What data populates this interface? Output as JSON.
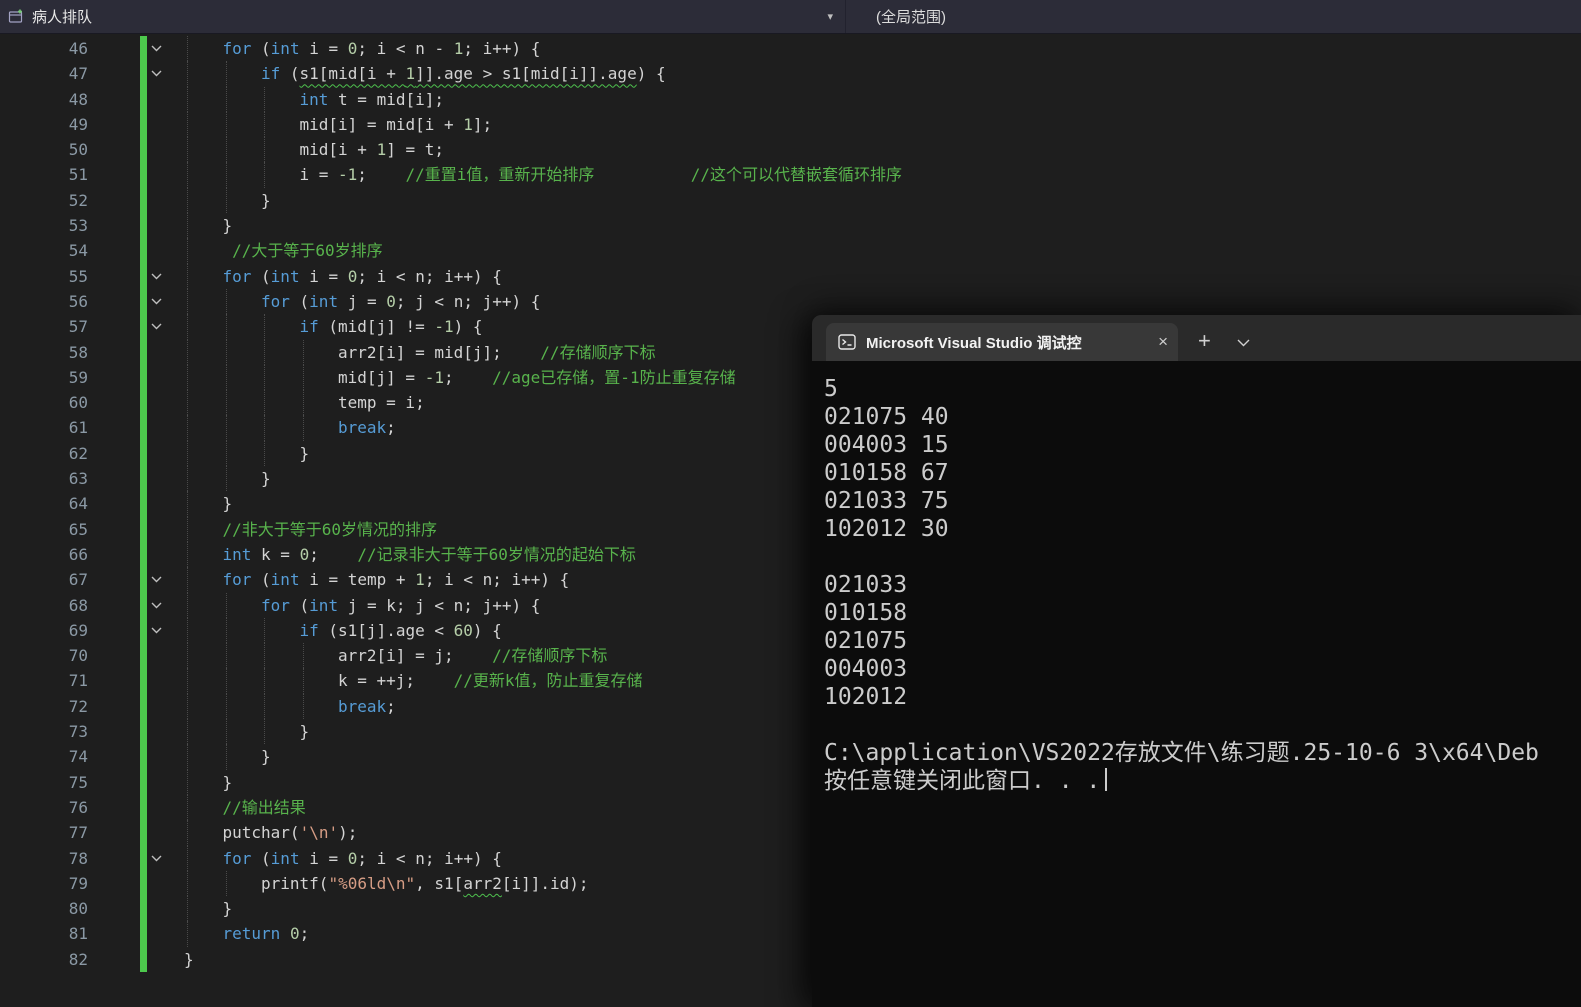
{
  "navbar": {
    "title": "病人排队",
    "scope": "(全局范围)"
  },
  "colors": {
    "editor_background": "#1e1e1e",
    "change_bar_green": "#4dc94d",
    "keyword_blue": "#569cd6",
    "comment_green": "#57a64a",
    "string_orange": "#d69d85",
    "number_green": "#b5cea8",
    "console_background": "#0c0c0c"
  },
  "editor": {
    "lines": [
      {
        "n": 46,
        "fold": true,
        "indent": 1,
        "segs": [
          [
            "kw",
            "for"
          ],
          [
            "pl",
            " ("
          ],
          [
            "kw",
            "int"
          ],
          [
            "pl",
            " i = "
          ],
          [
            "num",
            "0"
          ],
          [
            "pl",
            "; i < n - "
          ],
          [
            "num",
            "1"
          ],
          [
            "pl",
            "; i++) {"
          ]
        ]
      },
      {
        "n": 47,
        "fold": true,
        "indent": 2,
        "segs": [
          [
            "kw",
            "if"
          ],
          [
            "pl",
            " ("
          ],
          [
            "pl sq",
            "s1[mid[i + "
          ],
          [
            "num sq",
            "1"
          ],
          [
            "pl sq",
            "]].age > s1[mid[i]].age"
          ],
          [
            "pl",
            ") {"
          ]
        ]
      },
      {
        "n": 48,
        "fold": false,
        "indent": 3,
        "segs": [
          [
            "kw",
            "int"
          ],
          [
            "pl",
            " t = mid[i];"
          ]
        ]
      },
      {
        "n": 49,
        "fold": false,
        "indent": 3,
        "segs": [
          [
            "pl",
            "mid[i] = mid[i + "
          ],
          [
            "num",
            "1"
          ],
          [
            "pl",
            "];"
          ]
        ]
      },
      {
        "n": 50,
        "fold": false,
        "indent": 3,
        "segs": [
          [
            "pl",
            "mid[i + "
          ],
          [
            "num",
            "1"
          ],
          [
            "pl",
            "] = t;"
          ]
        ]
      },
      {
        "n": 51,
        "fold": false,
        "indent": 3,
        "segs": [
          [
            "pl",
            "i = "
          ],
          [
            "num",
            "-1"
          ],
          [
            "pl",
            ";    "
          ],
          [
            "com",
            "//重置i值，重新开始排序"
          ],
          [
            "pl",
            "          "
          ],
          [
            "com",
            "//这个可以代替嵌套循环排序"
          ]
        ]
      },
      {
        "n": 52,
        "fold": false,
        "indent": 2,
        "segs": [
          [
            "pl",
            "}"
          ]
        ]
      },
      {
        "n": 53,
        "fold": false,
        "indent": 1,
        "segs": [
          [
            "pl",
            "}"
          ]
        ]
      },
      {
        "n": 54,
        "fold": false,
        "indent": 1,
        "segs": [
          [
            "pl",
            " "
          ],
          [
            "com",
            "//大于等于60岁排序"
          ]
        ]
      },
      {
        "n": 55,
        "fold": true,
        "indent": 1,
        "segs": [
          [
            "kw",
            "for"
          ],
          [
            "pl",
            " ("
          ],
          [
            "kw",
            "int"
          ],
          [
            "pl",
            " i = "
          ],
          [
            "num",
            "0"
          ],
          [
            "pl",
            "; i < n; i++) {"
          ]
        ]
      },
      {
        "n": 56,
        "fold": true,
        "indent": 2,
        "segs": [
          [
            "kw",
            "for"
          ],
          [
            "pl",
            " ("
          ],
          [
            "kw",
            "int"
          ],
          [
            "pl",
            " j = "
          ],
          [
            "num",
            "0"
          ],
          [
            "pl",
            "; j < n; j++) {"
          ]
        ]
      },
      {
        "n": 57,
        "fold": true,
        "indent": 3,
        "segs": [
          [
            "kw",
            "if"
          ],
          [
            "pl",
            " (mid[j] != "
          ],
          [
            "num",
            "-1"
          ],
          [
            "pl",
            ") {"
          ]
        ]
      },
      {
        "n": 58,
        "fold": false,
        "indent": 4,
        "segs": [
          [
            "pl",
            "arr2[i] = mid[j];    "
          ],
          [
            "com",
            "//存储顺序下标"
          ]
        ]
      },
      {
        "n": 59,
        "fold": false,
        "indent": 4,
        "segs": [
          [
            "pl",
            "mid[j] = "
          ],
          [
            "num",
            "-1"
          ],
          [
            "pl",
            ";    "
          ],
          [
            "com",
            "//age已存储，置-1防止重复存储"
          ]
        ]
      },
      {
        "n": 60,
        "fold": false,
        "indent": 4,
        "segs": [
          [
            "pl",
            "temp = i;"
          ]
        ]
      },
      {
        "n": 61,
        "fold": false,
        "indent": 4,
        "segs": [
          [
            "kw",
            "break"
          ],
          [
            "pl",
            ";"
          ]
        ]
      },
      {
        "n": 62,
        "fold": false,
        "indent": 3,
        "segs": [
          [
            "pl",
            "}"
          ]
        ]
      },
      {
        "n": 63,
        "fold": false,
        "indent": 2,
        "segs": [
          [
            "pl",
            "}"
          ]
        ]
      },
      {
        "n": 64,
        "fold": false,
        "indent": 1,
        "segs": [
          [
            "pl",
            "}"
          ]
        ]
      },
      {
        "n": 65,
        "fold": false,
        "indent": 1,
        "segs": [
          [
            "com",
            "//非大于等于60岁情况的排序"
          ]
        ]
      },
      {
        "n": 66,
        "fold": false,
        "indent": 1,
        "segs": [
          [
            "kw",
            "int"
          ],
          [
            "pl",
            " k = "
          ],
          [
            "num",
            "0"
          ],
          [
            "pl",
            ";    "
          ],
          [
            "com",
            "//记录非大于等于60岁情况的起始下标"
          ]
        ]
      },
      {
        "n": 67,
        "fold": true,
        "indent": 1,
        "segs": [
          [
            "kw",
            "for"
          ],
          [
            "pl",
            " ("
          ],
          [
            "kw",
            "int"
          ],
          [
            "pl",
            " i = temp + "
          ],
          [
            "num",
            "1"
          ],
          [
            "pl",
            "; i < n; i++) {"
          ]
        ]
      },
      {
        "n": 68,
        "fold": true,
        "indent": 2,
        "segs": [
          [
            "kw",
            "for"
          ],
          [
            "pl",
            " ("
          ],
          [
            "kw",
            "int"
          ],
          [
            "pl",
            " j = k; j < n; j++) {"
          ]
        ]
      },
      {
        "n": 69,
        "fold": true,
        "indent": 3,
        "segs": [
          [
            "kw",
            "if"
          ],
          [
            "pl",
            " (s1[j].age < "
          ],
          [
            "num",
            "60"
          ],
          [
            "pl",
            ") {"
          ]
        ]
      },
      {
        "n": 70,
        "fold": false,
        "indent": 4,
        "segs": [
          [
            "pl",
            "arr2[i] = j;    "
          ],
          [
            "com",
            "//存储顺序下标"
          ]
        ]
      },
      {
        "n": 71,
        "fold": false,
        "indent": 4,
        "segs": [
          [
            "pl",
            "k = ++j;    "
          ],
          [
            "com",
            "//更新k值，防止重复存储"
          ]
        ]
      },
      {
        "n": 72,
        "fold": false,
        "indent": 4,
        "segs": [
          [
            "kw",
            "break"
          ],
          [
            "pl",
            ";"
          ]
        ]
      },
      {
        "n": 73,
        "fold": false,
        "indent": 3,
        "segs": [
          [
            "pl",
            "}"
          ]
        ]
      },
      {
        "n": 74,
        "fold": false,
        "indent": 2,
        "segs": [
          [
            "pl",
            "}"
          ]
        ]
      },
      {
        "n": 75,
        "fold": false,
        "indent": 1,
        "segs": [
          [
            "pl",
            "}"
          ]
        ]
      },
      {
        "n": 76,
        "fold": false,
        "indent": 1,
        "segs": [
          [
            "com",
            "//输出结果"
          ]
        ]
      },
      {
        "n": 77,
        "fold": false,
        "indent": 1,
        "segs": [
          [
            "pl",
            "putchar("
          ],
          [
            "str",
            "'\\n'"
          ],
          [
            "pl",
            ");"
          ]
        ]
      },
      {
        "n": 78,
        "fold": true,
        "indent": 1,
        "segs": [
          [
            "kw",
            "for"
          ],
          [
            "pl",
            " ("
          ],
          [
            "kw",
            "int"
          ],
          [
            "pl",
            " i = "
          ],
          [
            "num",
            "0"
          ],
          [
            "pl",
            "; i < n; i++) {"
          ]
        ]
      },
      {
        "n": 79,
        "fold": false,
        "indent": 2,
        "segs": [
          [
            "pl",
            "printf("
          ],
          [
            "str",
            "\"%06ld\\n\""
          ],
          [
            "pl",
            ", s1["
          ],
          [
            "pl sq",
            "arr2"
          ],
          [
            "pl",
            "[i]].id);"
          ]
        ]
      },
      {
        "n": 80,
        "fold": false,
        "indent": 1,
        "segs": [
          [
            "pl",
            "}"
          ]
        ]
      },
      {
        "n": 81,
        "fold": false,
        "indent": 1,
        "segs": [
          [
            "kw",
            "return"
          ],
          [
            "pl",
            " "
          ],
          [
            "num",
            "0"
          ],
          [
            "pl",
            ";"
          ]
        ]
      },
      {
        "n": 82,
        "fold": false,
        "indent": 0,
        "segs": [
          [
            "pl",
            "}"
          ]
        ]
      }
    ]
  },
  "console": {
    "tab_title": "Microsoft Visual Studio 调试控",
    "close_label": "×",
    "new_tab_label": "+",
    "lines": [
      "5",
      "021075 40",
      "004003 15",
      "010158 67",
      "021033 75",
      "102012 30",
      "",
      "021033",
      "010158",
      "021075",
      "004003",
      "102012",
      "",
      "C:\\application\\VS2022存放文件\\练习题.25-10-6 3\\x64\\Deb",
      "按任意键关闭此窗口. . ."
    ]
  }
}
